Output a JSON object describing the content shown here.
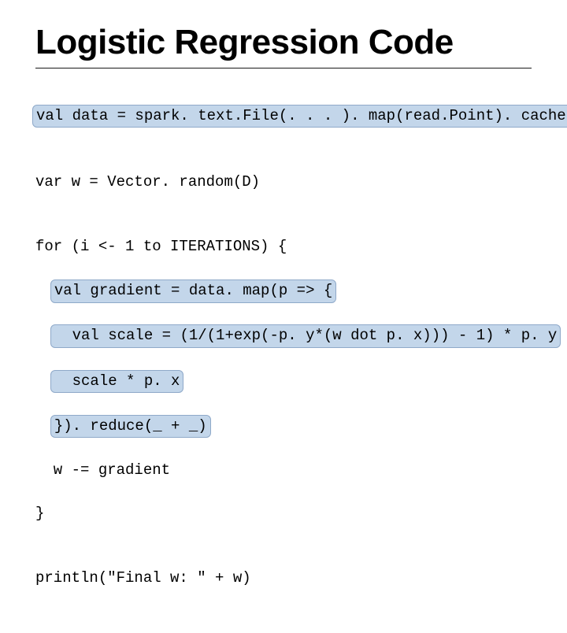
{
  "title": "Logistic Regression Code",
  "code": {
    "l1": "val data = spark. text.File(. . . ). map(read.Point). cache()",
    "l2": "",
    "l3": "var w = Vector. random(D)",
    "l4": "",
    "l5": "for (i <- 1 to ITERATIONS) {",
    "l6": "  val gradient = data. map(p => {",
    "l7": "    val scale = (1/(1+exp(-p. y*(w dot p. x))) - 1) * p. y",
    "l8": "    scale * p. x",
    "l9": "  }). reduce(_ + _)",
    "l10": "  w -= gradient",
    "l11": "}",
    "l12": "",
    "l13": "println(\"Final w: \" + w)"
  }
}
